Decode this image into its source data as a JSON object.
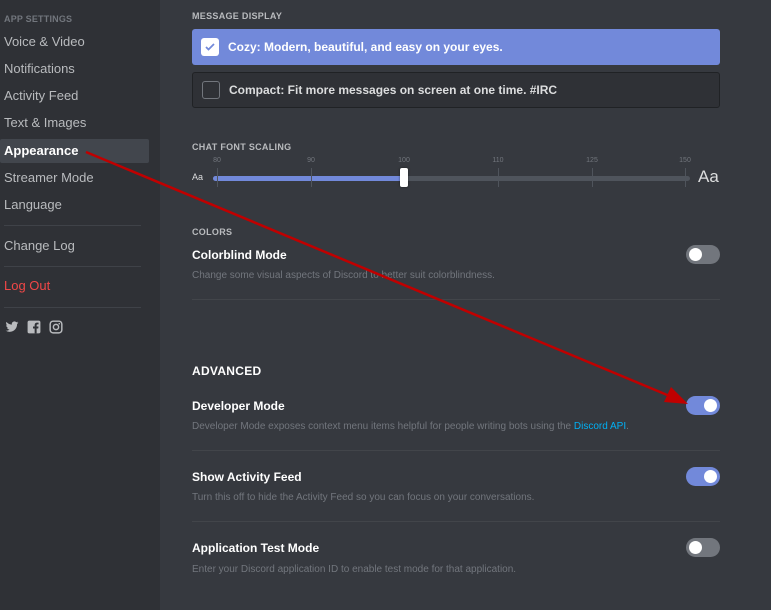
{
  "sidebar": {
    "header": "App Settings",
    "items": [
      {
        "label": "Voice & Video"
      },
      {
        "label": "Notifications"
      },
      {
        "label": "Activity Feed"
      },
      {
        "label": "Text & Images"
      },
      {
        "label": "Appearance"
      },
      {
        "label": "Streamer Mode"
      },
      {
        "label": "Language"
      }
    ],
    "change_log": "Change Log",
    "log_out": "Log Out",
    "social_icons": [
      "twitter-icon",
      "facebook-icon",
      "instagram-icon"
    ]
  },
  "message_display": {
    "title": "Message Display",
    "cozy": {
      "label": "Cozy: Modern, beautiful, and easy on your eyes.",
      "checked": true
    },
    "compact": {
      "label": "Compact: Fit more messages on screen at one time. #IRC",
      "checked": false
    }
  },
  "font_scaling": {
    "title": "Chat Font Scaling",
    "small_label": "Aa",
    "large_label": "Aa",
    "ticks": [
      "80",
      "90",
      "100",
      "110",
      "125",
      "150"
    ],
    "value": "100"
  },
  "colors": {
    "title": "Colors",
    "colorblind": {
      "title": "Colorblind Mode",
      "desc": "Change some visual aspects of Discord to better suit colorblindness.",
      "enabled": false
    }
  },
  "advanced": {
    "title": "ADVANCED",
    "developer": {
      "title": "Developer Mode",
      "desc": "Developer Mode exposes context menu items helpful for people writing bots using the ",
      "link": "Discord API",
      "desc_end": ".",
      "enabled": true
    },
    "activity": {
      "title": "Show Activity Feed",
      "desc": "Turn this off to hide the Activity Feed so you can focus on your conversations.",
      "enabled": true
    },
    "test_mode": {
      "title": "Application Test Mode",
      "desc": "Enter your Discord application ID to enable test mode for that application.",
      "enabled": false
    }
  },
  "colors_palette": {
    "blurple": "#7289da",
    "background": "#36393f",
    "sidebar": "#2f3136",
    "danger": "#f04747",
    "link": "#00b0f4",
    "annotation_arrow": "#c00000"
  }
}
